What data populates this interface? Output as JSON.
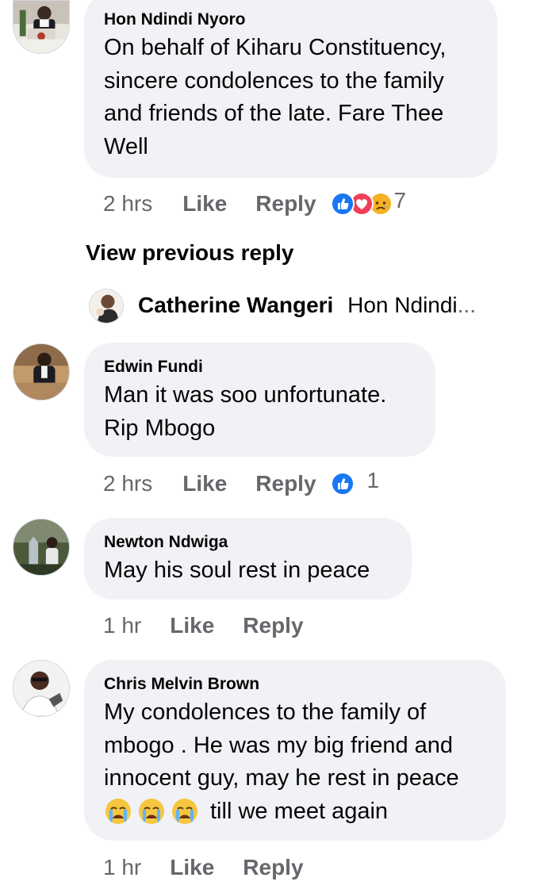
{
  "comments": [
    {
      "author": "Hon Ndindi Nyoro",
      "lines": [
        "On behalf of Kiharu Constituency,",
        "sincere condolences to the family",
        "and friends of the late. Fare Thee",
        "Well"
      ],
      "time": "2 hrs",
      "like_label": "Like",
      "reply_label": "Reply",
      "reaction_icons": [
        "like-reaction-icon",
        "love-reaction-icon",
        "sad-reaction-icon"
      ],
      "reaction_count": "7"
    },
    {
      "author": "Edwin Fundi",
      "lines": [
        "Man it was soo unfortunate.",
        "Rip Mbogo"
      ],
      "time": "2 hrs",
      "like_label": "Like",
      "reply_label": "Reply",
      "reaction_icons": [
        "like-reaction-icon"
      ],
      "reaction_count": "1"
    },
    {
      "author": "Newton Ndwiga",
      "lines": [
        "May his soul rest in peace"
      ],
      "time": "1 hr",
      "like_label": "Like",
      "reply_label": "Reply"
    },
    {
      "author": "Chris Melvin Brown",
      "lines": [
        "My condolences to the family of",
        "mbogo . He was my big friend and",
        "innocent guy, may he rest in peace"
      ],
      "emoji_line_text": "till we meet again",
      "emoji_icons": [
        "crying-face-icon",
        "crying-face-icon",
        "crying-face-icon"
      ],
      "time": "1 hr",
      "like_label": "Like",
      "reply_label": "Reply"
    }
  ],
  "view_previous_reply": "View previous reply",
  "collapsed_reply": {
    "author": "Catherine Wangeri",
    "preview": "Hon Ndindi",
    "ellipsis": "..."
  },
  "colors": {
    "bubble_bg": "#f0f2f5",
    "secondary_text": "#65676b",
    "like_blue": "#1877f2",
    "love_red": "#f33e58",
    "sad_yellow": "#f7b125"
  }
}
